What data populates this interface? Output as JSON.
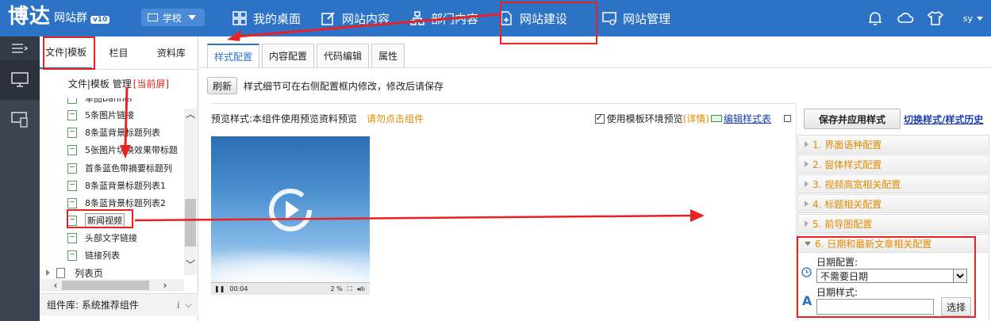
{
  "header": {
    "logo": "博达",
    "subtitle": "网站群",
    "version": "v10",
    "school_label": "学校",
    "nav": [
      {
        "label": "我的桌面",
        "icon": "desktop-grid-icon"
      },
      {
        "label": "网站内容",
        "icon": "edit-icon"
      },
      {
        "label": "部门内容",
        "icon": "org-chart-icon"
      },
      {
        "label": "网站建设",
        "icon": "build-icon"
      },
      {
        "label": "网站管理",
        "icon": "monitor-gear-icon"
      }
    ],
    "user": "sy"
  },
  "file_panel": {
    "tabs": [
      "文件|模板",
      "栏目",
      "资料库"
    ],
    "crumb": "文件|模板 管理",
    "crumb_current": "[当前屏]",
    "tree": [
      {
        "label": "单图banner"
      },
      {
        "label": "5条图片链接"
      },
      {
        "label": "8条蓝背景标题列表"
      },
      {
        "label": "5张图片切换效果带标题"
      },
      {
        "label": "首条蓝色带摘要标题列"
      },
      {
        "label": "8条蓝背景标题列表1"
      },
      {
        "label": "8条蓝背景标题列表2"
      },
      {
        "label": "新闻视频"
      },
      {
        "label": "头部文字链接"
      },
      {
        "label": "链接列表"
      }
    ],
    "folder": "列表页",
    "component_library": "组件库: 系统推荐组件"
  },
  "main": {
    "tabs": [
      "样式配置",
      "内容配置",
      "代码编辑",
      "属性"
    ],
    "refresh": "刷新",
    "hint": "样式细节可在右侧配置框内修改，修改后请保存",
    "preview_label": "预览样式:本组件使用预览资料预览",
    "preview_warning": "请勿点击组件",
    "use_template_env": "使用模板环境预览",
    "details": "(详情)",
    "edit_stylesheet": "编辑样式表",
    "video": {
      "time": "00:04",
      "volume_pct": "2 %"
    }
  },
  "config": {
    "save": "保存并应用样式",
    "history": "切换样式/样式历史",
    "items": [
      "1. 界面语种配置",
      "2. 窗体样式配置",
      "3. 视频高宽相关配置",
      "4. 标题相关配置",
      "5. 前导图配置",
      "6. 日期和最新文章相关配置"
    ],
    "date_config_label": "日期配置:",
    "date_config_value": "不需要日期",
    "date_style_label": "日期样式:",
    "choose": "选择"
  }
}
